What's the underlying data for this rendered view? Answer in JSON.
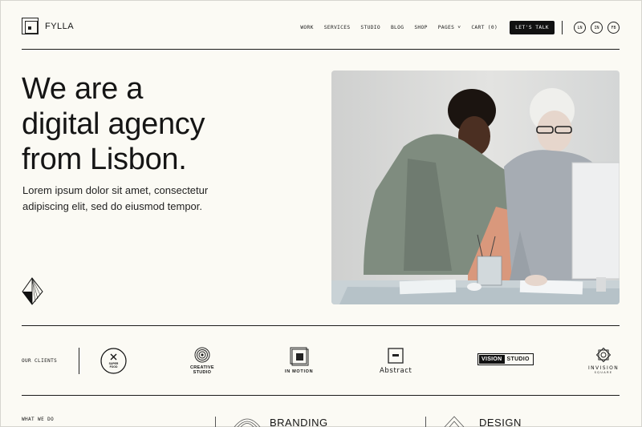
{
  "header": {
    "brand": "FYLLA",
    "nav": [
      "WORK",
      "SERVICES",
      "STUDIO",
      "BLOG",
      "SHOP",
      "PAGES ˅",
      "CART (0)"
    ],
    "cta": "LET'S TALK",
    "social": [
      "LN",
      "IN",
      "FB"
    ]
  },
  "hero": {
    "title_lines": [
      "We are a",
      "digital agency",
      "from Lisbon."
    ],
    "subtitle_lines": [
      "Lorem ipsum dolor sit amet, consectetur",
      "adipiscing elit, sed do eiusmod tempor."
    ]
  },
  "clients": {
    "label": "OUR CLIENTS",
    "logos": {
      "super_food_1": "SUPER",
      "super_food_2": "FOOD",
      "creative_1": "CREATIVE",
      "creative_2": "STUDIO",
      "inmotion": "IN MOTION",
      "abstract": "Abstract",
      "vision_1": "VISION",
      "vision_2": "STUDIO",
      "invision_1": "INVISION",
      "invision_2": "SQUARE"
    }
  },
  "services": {
    "label": "WHAT WE DO",
    "items": [
      "BRANDING",
      "DESIGN"
    ]
  },
  "colors": {
    "background": "#fbfaf4",
    "ink": "#151515",
    "accent_peach": "#d9987c"
  }
}
